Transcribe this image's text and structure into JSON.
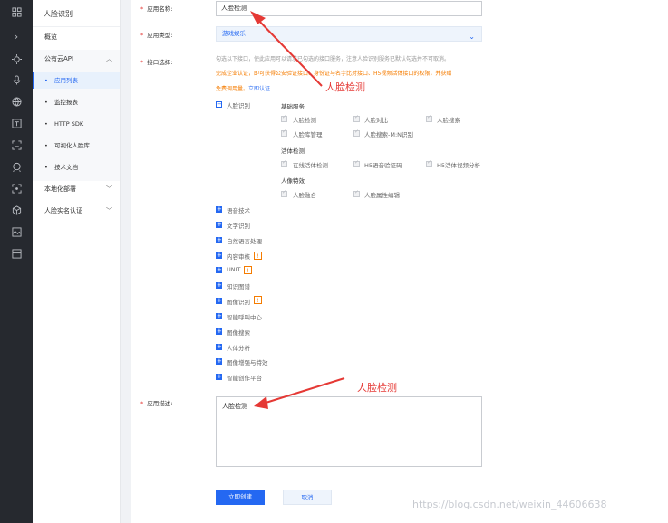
{
  "sidebar": {
    "title": "人脸识别",
    "overview": "概览",
    "public_api": "公有云API",
    "sub_items": [
      "应用列表",
      "监控报表",
      "HTTP SDK",
      "可视化人脸库",
      "技术文档"
    ],
    "local_deploy": "本地化部署",
    "realname_auth": "人脸实名认证"
  },
  "form": {
    "name_label": "应用名称:",
    "name_value": "人脸检测",
    "type_label": "应用类型:",
    "type_value": "游戏娱乐",
    "api_label": "接口选择:",
    "api_hint": "勾选以下接口，使此应用可以请求已勾选的接口服务，注意人脸识别服务已默认勾选并不可取消。",
    "api_warn": "完成企业认证，即可获得公安验证接口、身份证与名字比对接口、H5视频活体接口的权限，并获赠",
    "api_warn2": "免费调用量。",
    "auth_link": "立即认证",
    "desc_label": "应用描述:",
    "desc_value": "人脸检测"
  },
  "face": {
    "group_label": "人脸识别",
    "basic_title": "基础服务",
    "basic": [
      "人脸检测",
      "人脸对比",
      "人脸搜索",
      "人脸库管理",
      "人脸搜索-M:N识别"
    ],
    "liveness_title": "活体检测",
    "liveness": [
      "在线活体检测",
      "H5语音验证码",
      "H5活体视频分析"
    ],
    "effects_title": "人像特效",
    "effects": [
      "人脸融合",
      "人脸属性编辑"
    ]
  },
  "api_groups": [
    "语音技术",
    "文字识别",
    "自然语言处理",
    "内容审核",
    "UNIT",
    "知识图谱",
    "图像识别",
    "智能呼叫中心",
    "图像搜索",
    "人体分析",
    "图像增强与特效",
    "智能创作平台"
  ],
  "badge_text": "!",
  "buttons": {
    "create": "立即创建",
    "cancel": "取消"
  },
  "annotations": {
    "a1": "人脸检测",
    "a2": "人脸检测"
  },
  "watermark": "https://blog.csdn.net/weixin_44606638",
  "icons": [
    "grid-icon",
    "expand-icon",
    "settings-icon",
    "mic-icon",
    "globe-icon",
    "text-icon",
    "scan-face-icon",
    "face-id-icon",
    "body-icon",
    "cube-icon",
    "image-icon",
    "layout-icon"
  ],
  "colors": {
    "accent": "#2468f2",
    "annotation": "#e53935",
    "warning": "#f57c00"
  }
}
